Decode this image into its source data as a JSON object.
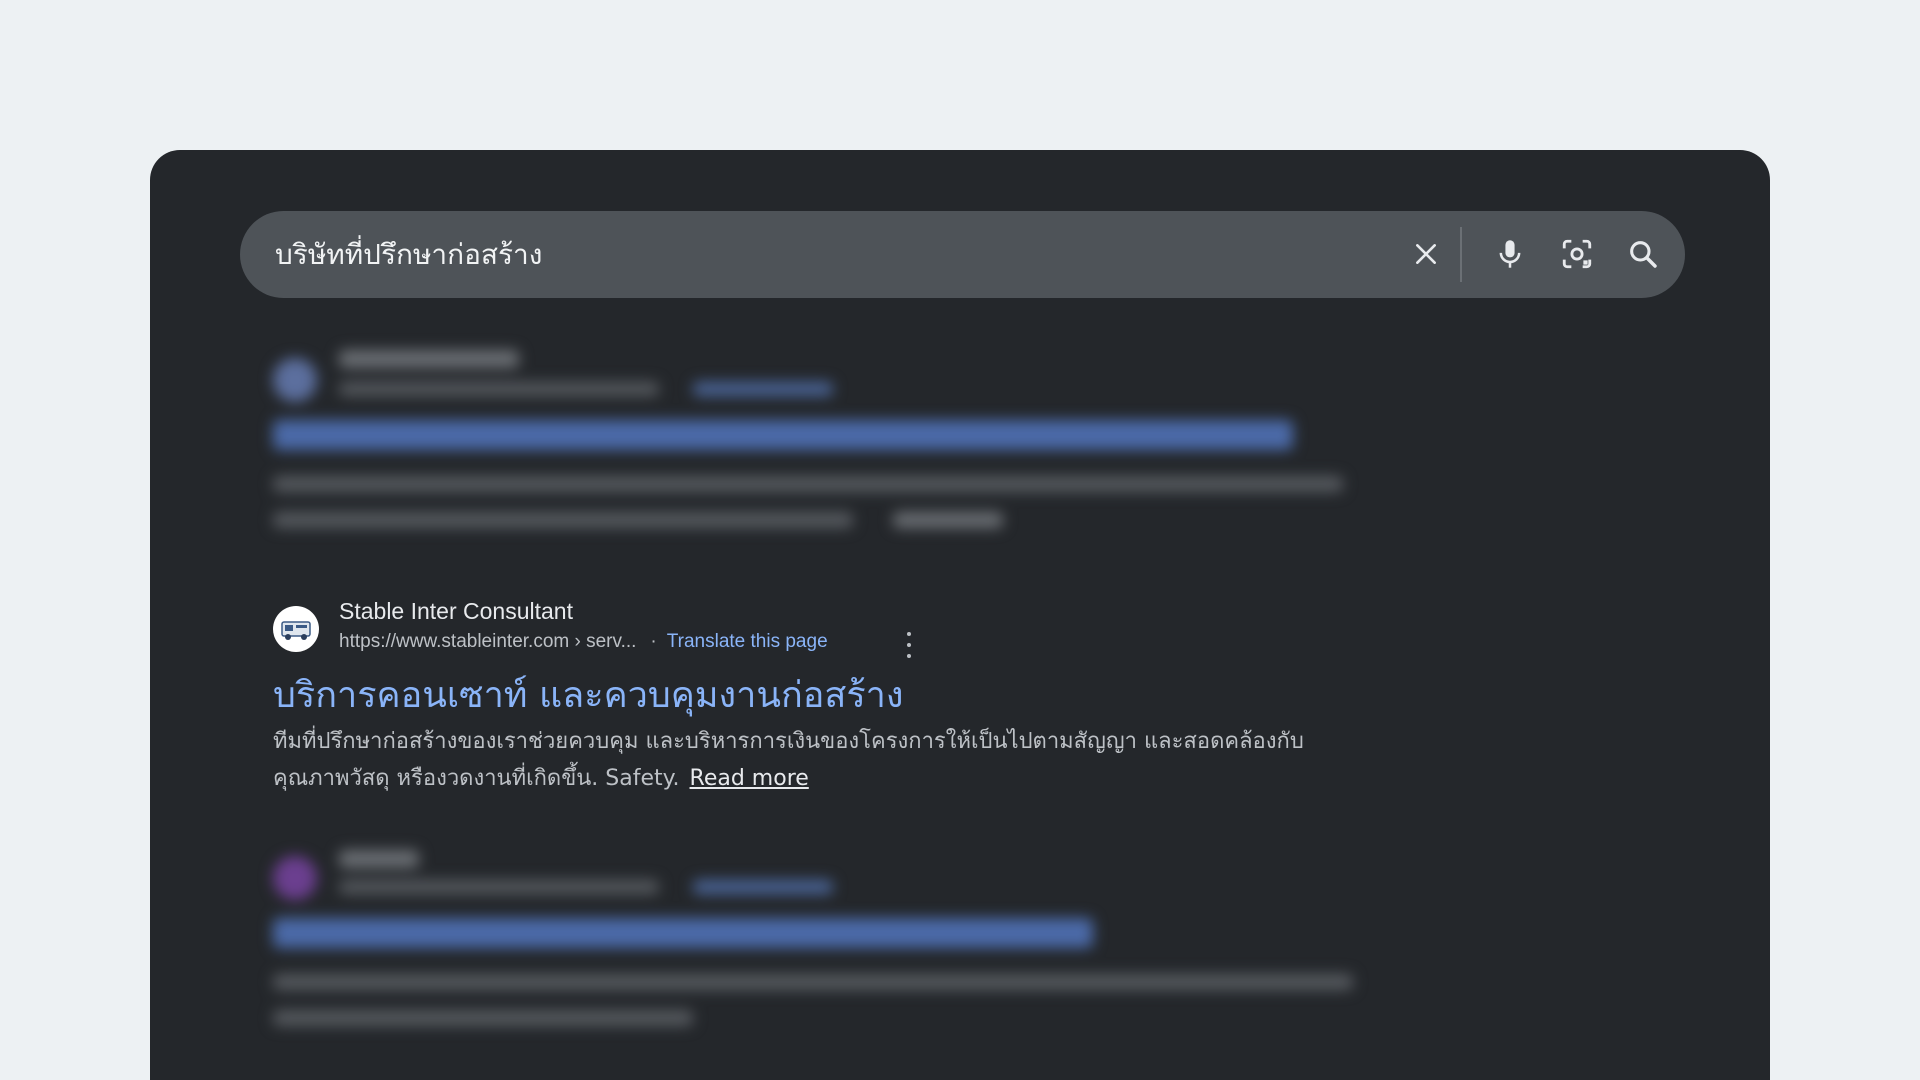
{
  "search": {
    "query": "บริษัทที่ปรึกษาก่อสร้าง",
    "clear_icon": "close-icon",
    "voice_icon": "microphone-icon",
    "lens_icon": "camera-lens-icon",
    "search_icon": "search-icon"
  },
  "focused_result": {
    "site_name": "Stable Inter Consultant",
    "url": "https://www.stableinter.com › serv...",
    "translate_label": "Translate this page",
    "title": "บริการคอนเซาท์ และควบคุมงานก่อสร้าง",
    "snippet_line1": "ทีมที่ปรึกษาก่อสร้างของเราช่วยควบคุม และบริหารการเงินของโครงการให้เป็นไปตามสัญญา และสอดคล้องกับ",
    "snippet_line2": "คุณภาพวัสดุ หรืองวดงานที่เกิดขึ้น. Safety.",
    "read_more": "Read more"
  },
  "colors": {
    "page_bg": "#edf1f3",
    "panel_bg": "#24272b",
    "searchbar_bg": "#4e5358",
    "link_blue": "#8ab4f8",
    "text_primary": "#e8eaed",
    "text_secondary": "#bdc1c6"
  }
}
